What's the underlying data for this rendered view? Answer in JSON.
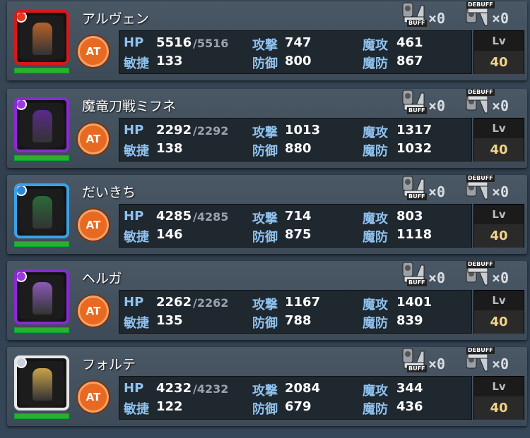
{
  "labels": {
    "hp": "HP",
    "agility": "敏捷",
    "attack": "攻撃",
    "defense": "防御",
    "mattack": "魔攻",
    "mdefense": "魔防",
    "lv": "Lv",
    "at": "AT",
    "buff_tag": "BUFF",
    "debuff_tag": "DEBUFF"
  },
  "units": [
    {
      "name": "アルヴェン",
      "frame_color": "#d41a1a",
      "element_color": "#e23b1a",
      "hp": "5516",
      "hp_max": "/5516",
      "attack": "747",
      "mattack": "461",
      "agility": "133",
      "defense": "800",
      "mdefense": "867",
      "lv": "40",
      "buff": "×0",
      "debuff": "×0"
    },
    {
      "name": "魔竜刀戦ミフネ",
      "frame_color": "#8a2ad4",
      "element_color": "#9b3bdc",
      "hp": "2292",
      "hp_max": "/2292",
      "attack": "1013",
      "mattack": "1317",
      "agility": "138",
      "defense": "880",
      "mdefense": "1032",
      "lv": "40",
      "buff": "×0",
      "debuff": "×0"
    },
    {
      "name": "だいきち",
      "frame_color": "#3aa2e6",
      "element_color": "#2f86d6",
      "hp": "4285",
      "hp_max": "/4285",
      "attack": "714",
      "mattack": "803",
      "agility": "146",
      "defense": "875",
      "mdefense": "1118",
      "lv": "40",
      "buff": "×0",
      "debuff": "×0"
    },
    {
      "name": "ヘルガ",
      "frame_color": "#8a2ad4",
      "element_color": "#9b3bdc",
      "hp": "2262",
      "hp_max": "/2262",
      "attack": "1167",
      "mattack": "1401",
      "agility": "135",
      "defense": "788",
      "mdefense": "839",
      "lv": "40",
      "buff": "×0",
      "debuff": "×0"
    },
    {
      "name": "フォルテ",
      "frame_color": "#e8e8e8",
      "element_color": "#c8d2dc",
      "hp": "4232",
      "hp_max": "/4232",
      "attack": "2084",
      "mattack": "344",
      "agility": "122",
      "defense": "679",
      "mdefense": "436",
      "lv": "40",
      "buff": "×0",
      "debuff": "×0"
    }
  ]
}
